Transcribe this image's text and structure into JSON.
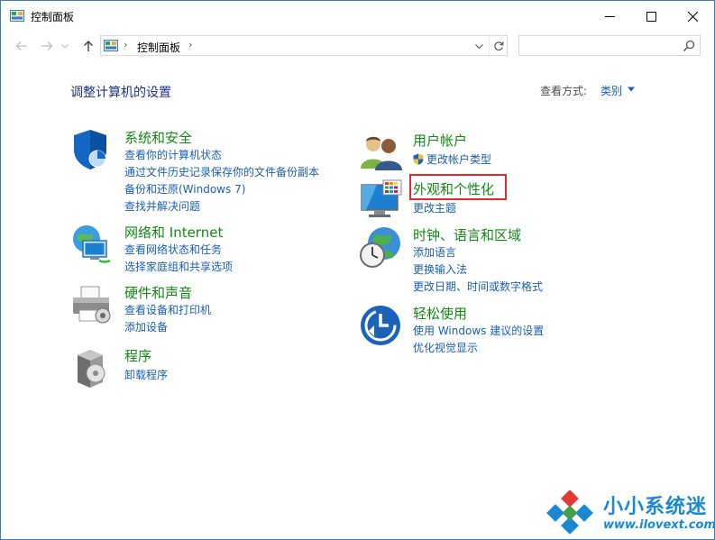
{
  "window": {
    "title": "控制面板",
    "controls": {
      "minimize": "minimize-icon",
      "maximize": "maximize-icon",
      "close": "close-icon"
    }
  },
  "navigation": {
    "back": "arrow-left-icon",
    "forward": "arrow-right-icon",
    "recent": "chevron-down-icon",
    "up": "arrow-up-icon",
    "address_separator": "›",
    "breadcrumb": "控制面板",
    "refresh": "refresh-icon",
    "search_placeholder": ""
  },
  "main": {
    "title": "调整计算机的设置",
    "view_by_label": "查看方式:",
    "view_by_value": "类别"
  },
  "categories_left": [
    {
      "title": "系统和安全",
      "icon": "shield-icon",
      "links": [
        "查看你的计算机状态",
        "通过文件历史记录保存你的文件备份副本",
        "备份和还原(Windows 7)",
        "查找并解决问题"
      ]
    },
    {
      "title": "网络和 Internet",
      "icon": "network-globe-icon",
      "links": [
        "查看网络状态和任务",
        "选择家庭组和共享选项"
      ]
    },
    {
      "title": "硬件和声音",
      "icon": "printer-icon",
      "links": [
        "查看设备和打印机",
        "添加设备"
      ]
    },
    {
      "title": "程序",
      "icon": "programs-disc-icon",
      "links": [
        "卸载程序"
      ]
    }
  ],
  "categories_right": [
    {
      "title": "用户帐户",
      "icon": "users-icon",
      "links": [
        "更改帐户类型"
      ]
    },
    {
      "title": "外观和个性化",
      "icon": "monitor-palette-icon",
      "links": [
        "更改主题"
      ]
    },
    {
      "title": "时钟、语言和区域",
      "icon": "clock-globe-icon",
      "links": [
        "添加语言",
        "更换输入法",
        "更改日期、时间或数字格式"
      ]
    },
    {
      "title": "轻松使用",
      "icon": "ease-of-access-icon",
      "links": [
        "使用 Windows 建议的设置",
        "优化视觉显示"
      ]
    }
  ],
  "watermark": {
    "name": "小小系统迷",
    "url": "www.ilovext.com"
  },
  "colors": {
    "category_title": "#128a12",
    "link": "#1a5fb4",
    "page_title": "#1e3287",
    "highlight": "#e12a2a",
    "watermark": "#1b88d4"
  }
}
